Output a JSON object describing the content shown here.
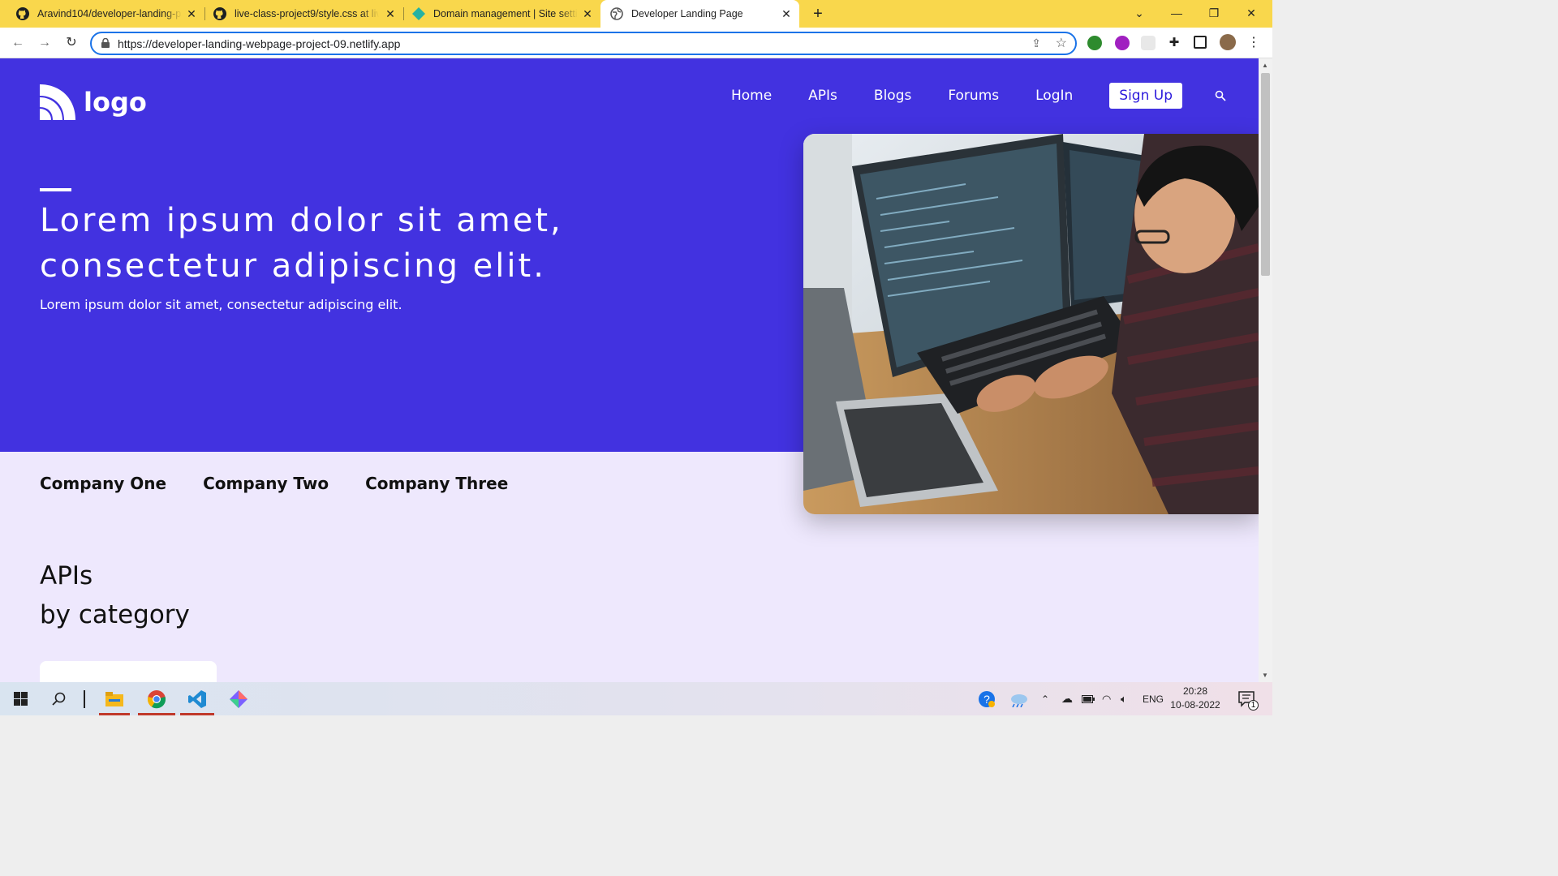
{
  "browser": {
    "tabs": [
      {
        "title": "Aravind104/developer-landing-page",
        "icon": "github-icon"
      },
      {
        "title": "live-class-project9/style.css at live",
        "icon": "github-icon"
      },
      {
        "title": "Domain management | Site settings",
        "icon": "netlify-icon"
      },
      {
        "title": "Developer Landing Page",
        "icon": "globe-icon"
      }
    ],
    "url": "https://developer-landing-webpage-project-09.netlify.app"
  },
  "page": {
    "logo_text": "logo",
    "nav": {
      "home": "Home",
      "apis": "APIs",
      "blogs": "Blogs",
      "forums": "Forums",
      "login": "LogIn",
      "signup": "Sign Up"
    },
    "hero": {
      "title_line1": "Lorem ipsum dolor sit amet,",
      "title_line2": "consectetur adipiscing elit.",
      "subtitle": "Lorem ipsum dolor sit amet, consectetur adipiscing elit."
    },
    "companies": [
      "Company One",
      "Company Two",
      "Company Three"
    ],
    "apis_title_line1": "APIs",
    "apis_title_line2": "by category"
  },
  "taskbar": {
    "language": "ENG",
    "time": "20:28",
    "date": "10-08-2022",
    "notification_count": "1"
  },
  "colors": {
    "tabstrip": "#f9d74c",
    "hero": "#4232e0",
    "page_bg": "#eee8fd",
    "signup_text": "#2d1bdc"
  }
}
